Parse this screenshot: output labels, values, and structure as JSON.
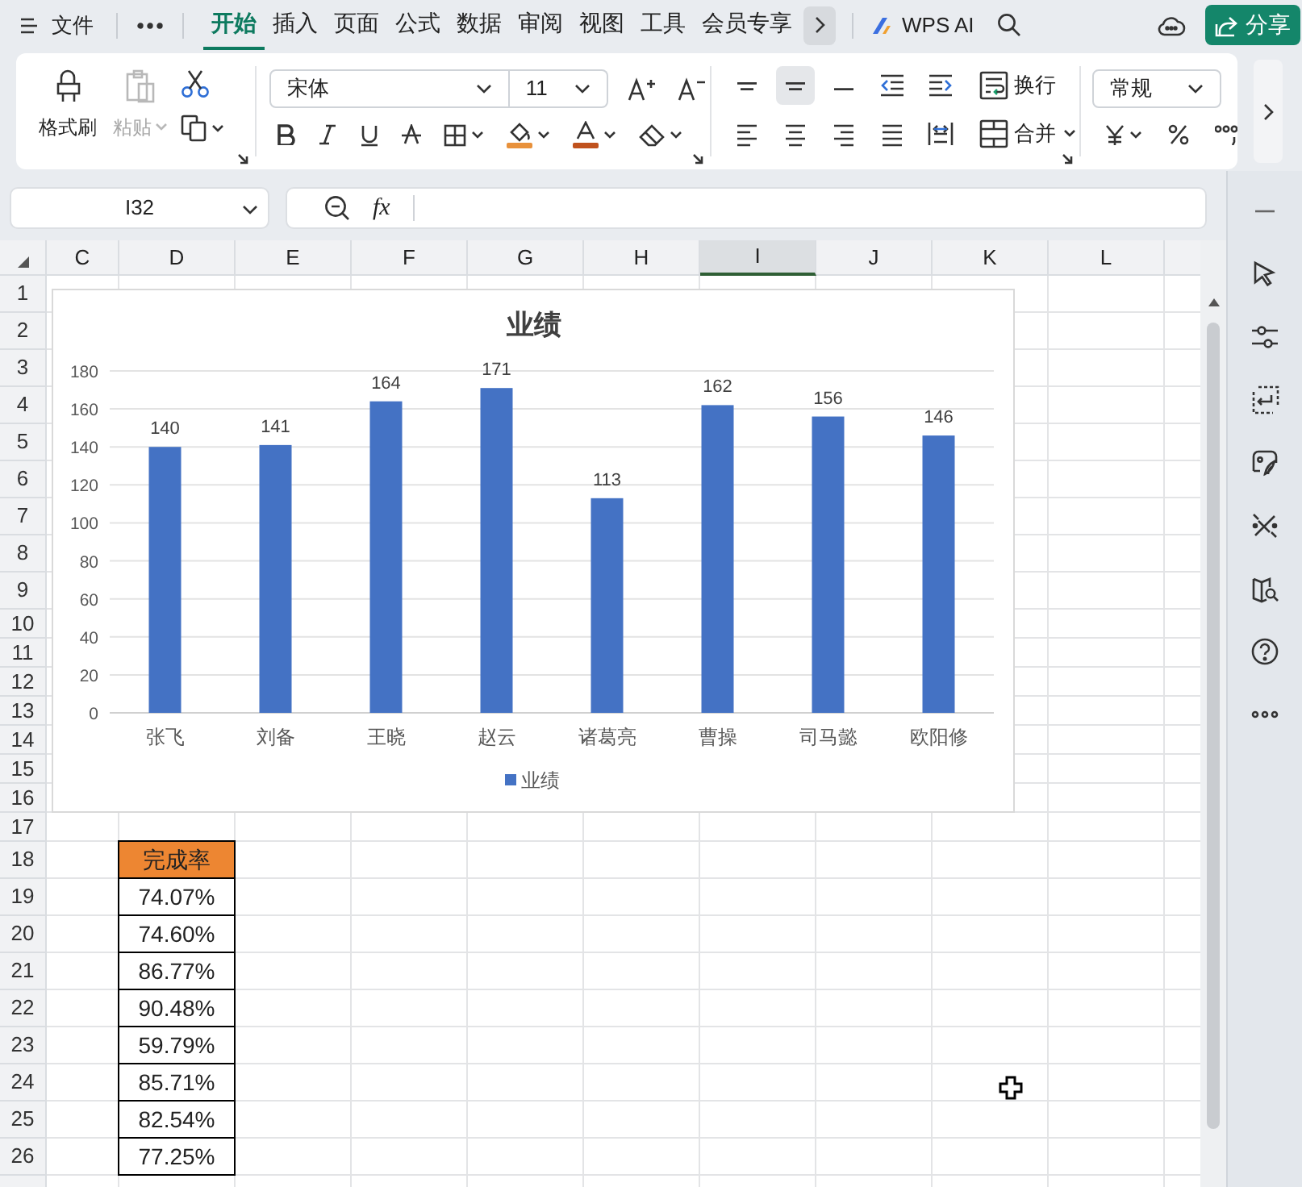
{
  "menu_bar": {
    "file_menu": "文件",
    "tabs": [
      {
        "label": "开始",
        "selected": true
      },
      {
        "label": "插入",
        "selected": false
      },
      {
        "label": "页面",
        "selected": false
      },
      {
        "label": "公式",
        "selected": false
      },
      {
        "label": "数据",
        "selected": false
      },
      {
        "label": "审阅",
        "selected": false
      },
      {
        "label": "视图",
        "selected": false
      },
      {
        "label": "工具",
        "selected": false
      },
      {
        "label": "会员专享",
        "selected": false
      }
    ],
    "ai_button": "WPS AI",
    "share_button": "分享"
  },
  "ribbon": {
    "format_painter": "格式刷",
    "paste": {
      "label": "粘贴",
      "disabled": true
    },
    "font_name": "宋体",
    "font_size": "11",
    "vertical_align": [
      {
        "selected": false
      },
      {
        "selected": true
      },
      {
        "selected": false
      }
    ],
    "wrap_button": "换行",
    "merge_button": "合并",
    "number_format": "常规"
  },
  "formula_bar": {
    "cell_reference": "I32",
    "function_label": "fx"
  },
  "sheet": {
    "columns": [
      {
        "label": "C",
        "selected": false
      },
      {
        "label": "D",
        "selected": false
      },
      {
        "label": "E",
        "selected": false
      },
      {
        "label": "F",
        "selected": false
      },
      {
        "label": "G",
        "selected": false
      },
      {
        "label": "H",
        "selected": false
      },
      {
        "label": "I",
        "selected": true
      },
      {
        "label": "J",
        "selected": false
      },
      {
        "label": "K",
        "selected": false
      },
      {
        "label": "L",
        "selected": false
      }
    ],
    "rows": [
      "1",
      "2",
      "3",
      "4",
      "5",
      "6",
      "7",
      "8",
      "9",
      "10",
      "11",
      "12",
      "13",
      "14",
      "15",
      "16",
      "17",
      "18",
      "19",
      "20",
      "21",
      "22",
      "23",
      "24",
      "25",
      "26"
    ],
    "table": {
      "header": "完成率",
      "values": [
        "74.07%",
        "74.60%",
        "86.77%",
        "90.48%",
        "59.79%",
        "85.71%",
        "82.54%",
        "77.25%"
      ]
    }
  },
  "chart": {
    "chart_data": {
      "type": "bar",
      "title": "业绩",
      "categories": [
        "张飞",
        "刘备",
        "王晓",
        "赵云",
        "诸葛亮",
        "曹操",
        "司马懿",
        "欧阳修"
      ],
      "series": [
        {
          "name": "业绩",
          "color": "#4472c4",
          "values": [
            140,
            141,
            164,
            171,
            113,
            162,
            156,
            146
          ]
        }
      ],
      "grid": true,
      "ylim": [
        0,
        180
      ],
      "yticks": [
        0,
        20,
        40,
        60,
        80,
        100,
        120,
        140,
        160,
        180
      ],
      "data_labels": true
    }
  }
}
